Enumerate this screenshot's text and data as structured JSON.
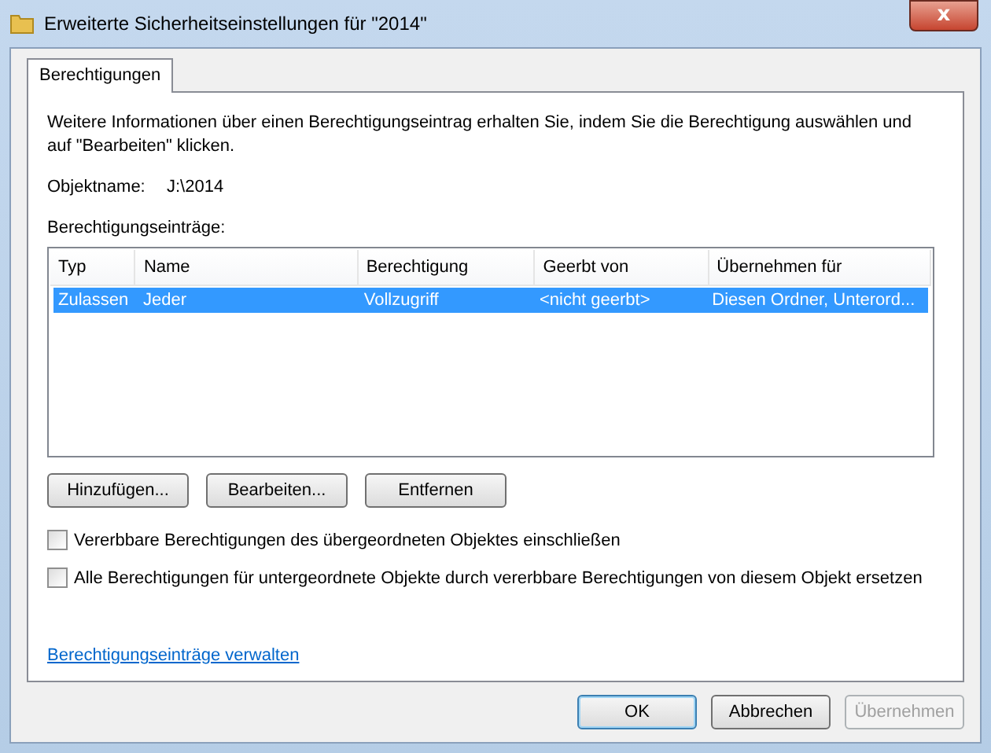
{
  "window": {
    "title": "Erweiterte Sicherheitseinstellungen für \"2014\"",
    "close": "x"
  },
  "tabs": [
    {
      "label": "Berechtigungen",
      "selected": true
    }
  ],
  "info": "Weitere Informationen über einen Berechtigungseintrag erhalten Sie, indem Sie die Berechtigung auswählen und auf \"Bearbeiten\" klicken.",
  "object": {
    "label": "Objektname:",
    "value": "J:\\2014"
  },
  "list_label": "Berechtigungseinträge:",
  "table": {
    "columns": [
      "Typ",
      "Name",
      "Berechtigung",
      "Geerbt von",
      "Übernehmen für"
    ],
    "rows": [
      {
        "cells": [
          "Zulassen",
          "Jeder",
          "Vollzugriff",
          "<nicht geerbt>",
          "Diesen Ordner, Unterord..."
        ],
        "selected": true
      }
    ]
  },
  "list_buttons": [
    "Hinzufügen...",
    "Bearbeiten...",
    "Entfernen"
  ],
  "checkboxes": [
    {
      "label": "Vererbbare Berechtigungen des übergeordneten Objektes einschließen",
      "checked": false
    },
    {
      "label": "Alle Berechtigungen für untergeordnete Objekte durch vererbbare Berechtigungen von diesem Objekt ersetzen",
      "checked": false
    }
  ],
  "link": "Berechtigungseinträge verwalten",
  "buttons": [
    {
      "label": "OK",
      "default": true,
      "disabled": false
    },
    {
      "label": "Abbrechen",
      "default": false,
      "disabled": false
    },
    {
      "label": "Übernehmen",
      "default": false,
      "disabled": true
    }
  ]
}
